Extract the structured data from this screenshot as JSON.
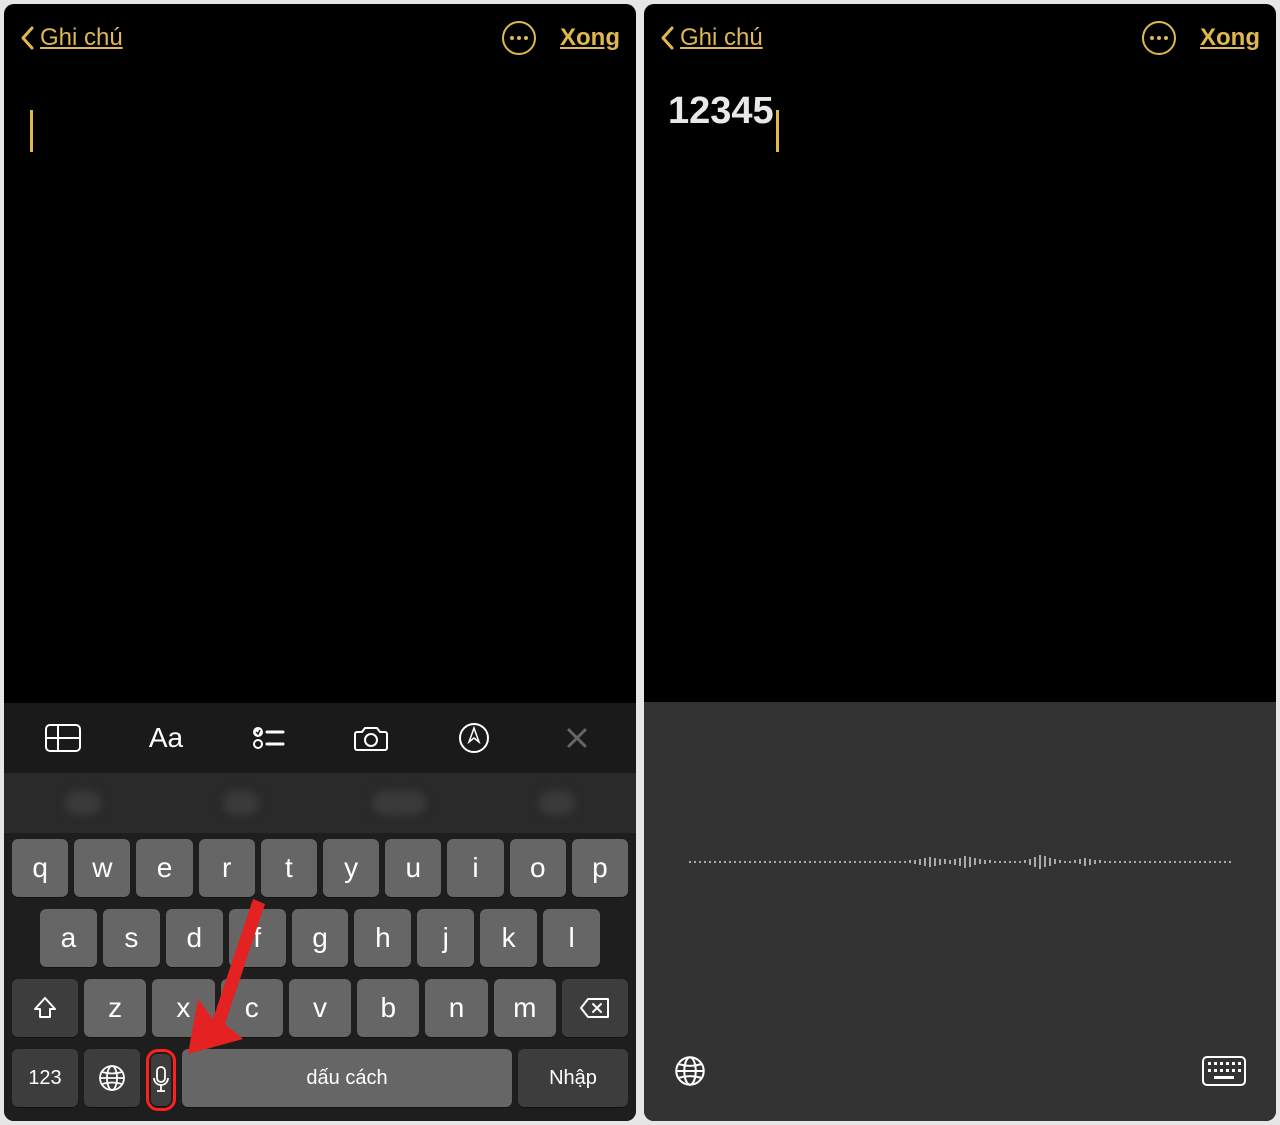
{
  "left": {
    "header": {
      "back": "Ghi chú",
      "done": "Xong"
    },
    "note": {
      "text": ""
    },
    "format_bar": {
      "table": "table-icon",
      "font": "Aa",
      "list": "list-icon",
      "camera": "camera-icon",
      "pen": "pen-icon",
      "close": "close-icon"
    },
    "keyboard": {
      "row1": [
        "q",
        "w",
        "e",
        "r",
        "t",
        "y",
        "u",
        "i",
        "o",
        "p"
      ],
      "row2": [
        "a",
        "s",
        "d",
        "f",
        "g",
        "h",
        "j",
        "k",
        "l"
      ],
      "row3": [
        "z",
        "x",
        "c",
        "v",
        "b",
        "n",
        "m"
      ],
      "num": "123",
      "space": "dấu cách",
      "enter": "Nhập"
    }
  },
  "right": {
    "header": {
      "back": "Ghi chú",
      "done": "Xong"
    },
    "note": {
      "text": "12345"
    }
  },
  "colors": {
    "accent": "#e0b94d",
    "highlight": "#ff2020"
  }
}
